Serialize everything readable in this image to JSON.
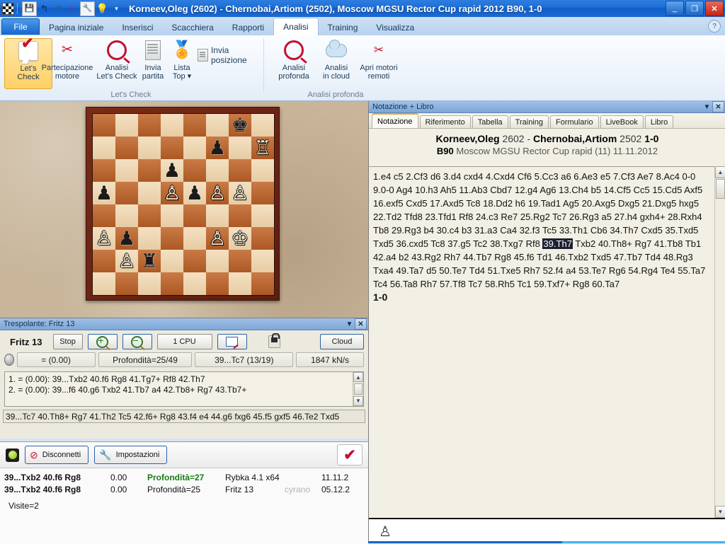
{
  "window": {
    "title": "Korneev,Oleg (2602) - Chernobai,Artiom (2502), Moscow MGSU Rector Cup rapid 2012  B90, 1-0",
    "quick_access": [
      "app-logo",
      "save-icon",
      "undo-icon",
      "redo-icon",
      "board-edit-icon",
      "wrench-icon",
      "lightbulb-icon",
      "chevron-down-icon"
    ],
    "controls": {
      "minimize": "_",
      "restore": "❐",
      "close": "✕"
    }
  },
  "ribbon": {
    "file_tab": "File",
    "tabs": [
      {
        "label": "Pagina iniziale",
        "active": false
      },
      {
        "label": "Inserisci",
        "active": false
      },
      {
        "label": "Scacchiera",
        "active": false
      },
      {
        "label": "Rapporti",
        "active": false
      },
      {
        "label": "Analisi",
        "active": true
      },
      {
        "label": "Training",
        "active": false
      },
      {
        "label": "Visualizza",
        "active": false
      }
    ],
    "help": "?",
    "groups": [
      {
        "name": "Let's Check",
        "buttons": [
          {
            "label": "Let's\nCheck",
            "icon": "lets-check-icon",
            "selected": true
          },
          {
            "label": "Partecipazione\nmotore",
            "icon": "engine-participation-icon",
            "selected": false
          },
          {
            "label": "Analisi\nLet's Check",
            "icon": "analysis-lets-check-icon",
            "selected": false
          },
          {
            "label": "Invia\npartita",
            "icon": "send-game-icon",
            "selected": false
          },
          {
            "label": "Lista\nTop ▾",
            "icon": "top-list-icon",
            "selected": false
          }
        ],
        "small_buttons": [
          {
            "label": "Invia posizione",
            "icon": "send-position-icon"
          }
        ]
      },
      {
        "name": "Analisi profonda",
        "buttons": [
          {
            "label": "Analisi\nprofonda",
            "icon": "deep-analysis-icon",
            "selected": false
          },
          {
            "label": "Analisi\nin cloud",
            "icon": "cloud-analysis-icon",
            "selected": false
          },
          {
            "label": "Apri motori\nremoti",
            "icon": "open-remote-engines-icon",
            "selected": false
          }
        ],
        "small_buttons": []
      }
    ]
  },
  "board": {
    "orientation": "white-bottom",
    "pieces": [
      {
        "square": "g8",
        "piece": "black-king",
        "glyph": "♚",
        "color": "b"
      },
      {
        "square": "f7",
        "piece": "black-pawn",
        "glyph": "♟",
        "color": "b"
      },
      {
        "square": "h7",
        "piece": "white-rook",
        "glyph": "♖",
        "color": "w"
      },
      {
        "square": "d6",
        "piece": "black-pawn",
        "glyph": "♟",
        "color": "b"
      },
      {
        "square": "a5",
        "piece": "black-pawn",
        "glyph": "♟",
        "color": "b"
      },
      {
        "square": "d5",
        "piece": "white-pawn",
        "glyph": "♙",
        "color": "w"
      },
      {
        "square": "e5",
        "piece": "black-pawn",
        "glyph": "♟",
        "color": "b"
      },
      {
        "square": "f5",
        "piece": "white-pawn",
        "glyph": "♙",
        "color": "w"
      },
      {
        "square": "g5",
        "piece": "white-pawn",
        "glyph": "♙",
        "color": "w"
      },
      {
        "square": "a3",
        "piece": "white-pawn",
        "glyph": "♙",
        "color": "w"
      },
      {
        "square": "b3",
        "piece": "black-pawn",
        "glyph": "♟",
        "color": "b"
      },
      {
        "square": "f3",
        "piece": "white-pawn",
        "glyph": "♙",
        "color": "w"
      },
      {
        "square": "g3",
        "piece": "white-king",
        "glyph": "♔",
        "color": "w"
      },
      {
        "square": "b2",
        "piece": "white-pawn",
        "glyph": "♙",
        "color": "w"
      },
      {
        "square": "c2",
        "piece": "black-rook",
        "glyph": "♜",
        "color": "b"
      }
    ]
  },
  "engine_panel": {
    "caption": "Trespolante: Fritz 13",
    "engine_name": "Fritz 13",
    "stop_label": "Stop",
    "zoom_in": "zoom-in",
    "zoom_out": "zoom-out",
    "cpu_label": "1 CPU",
    "edit_label": "edit",
    "lock_label": "lock",
    "cloud_label": "Cloud",
    "evaluation": "=  (0.00)",
    "depth": "Profondità=25/49",
    "current_move": "39...Tc7 (13/19)",
    "speed": "1847 kN/s",
    "variations": [
      "1. =  (0.00): 39...Txb2 40.f6 Rg8 41.Tg7+ Rf8 42.Th7",
      "2. =  (0.00): 39...f6 40.g6 Txb2 41.Tb7 a4 42.Tb8+ Rg7 43.Tb7+"
    ],
    "bottom_line": "39...Tc7 40.Th8+ Rg7 41.Th2 Tc5 42.f6+ Rg8 43.f4 e4 44.g6 fxg6 45.f5 gxf5 46.Te2 Txd5"
  },
  "lets_check_panel": {
    "status_led": "green",
    "disconnect_label": "Disconnetti",
    "settings_label": "Impostazioni",
    "flag_icon": "lets-check-flag-icon",
    "rows": [
      {
        "move": "39...Txb2 40.f6 Rg8",
        "eval": "0.00",
        "depth": "Profondità=27",
        "engine": "Rybka 4.1 x64",
        "user": "",
        "date": "11.11.2",
        "highlight": true
      },
      {
        "move": "39...Txb2 40.f6 Rg8",
        "eval": "0.00",
        "depth": "Profondità=25",
        "engine": "Fritz 13",
        "user": "cyrano",
        "date": "05.12.2",
        "highlight": false
      }
    ],
    "visits": "Visite=2"
  },
  "notation_panel": {
    "caption": "Notazione + Libro",
    "tabs": [
      {
        "label": "Notazione",
        "active": true
      },
      {
        "label": "Riferimento",
        "active": false
      },
      {
        "label": "Tabella",
        "active": false
      },
      {
        "label": "Training",
        "active": false
      },
      {
        "label": "Formulario",
        "active": false
      },
      {
        "label": "LiveBook",
        "active": false
      },
      {
        "label": "Libro",
        "active": false
      }
    ],
    "header": {
      "white": "Korneev,Oleg",
      "white_elo": "2602",
      "dash": "-",
      "black": "Chernobai,Artiom",
      "black_elo": "2502",
      "result": "1-0",
      "eco": "B90",
      "event": "Moscow MGSU Rector Cup rapid (11) 11.11.2012"
    },
    "moves_before": "1.e4 c5 2.Cf3 d6 3.d4 cxd4 4.Cxd4 Cf6 5.Cc3 a6 6.Ae3 e5 7.Cf3 Ae7 8.Ac4 0-0 9.0-0 Ag4 10.h3 Ah5 11.Ab3 Cbd7 12.g4 Ag6 13.Ch4 b5 14.Cf5 Cc5 15.Cd5 Axf5 16.exf5 Cxd5 17.Axd5 Tc8 18.Dd2 h6 19.Tad1 Ag5 20.Axg5 Dxg5 21.Dxg5 hxg5 22.Td2 Tfd8 23.Tfd1 Rf8 24.c3 Re7 25.Rg2 Tc7 26.Rg3 a5 27.h4 gxh4+ 28.Rxh4 Tb8 29.Rg3 b4 30.c4 b3 31.a3 Ca4 32.f3 Tc5 33.Th1 Cb6 34.Th7 Cxd5 35.Txd5 Txd5 36.cxd5 Tc8 37.g5 Tc2 38.Txg7 Rf8 ",
    "current_move": "39.Th7",
    "moves_after": " Txb2 40.Th8+ Rg7 41.Tb8 Tb1 42.a4 b2 43.Rg2 Rh7 44.Tb7 Rg8 45.f6 Td1 46.Txb2 Txd5 47.Tb7 Td4 48.Rg3 Txa4 49.Ta7 d5 50.Te7 Td4 51.Txe5 Rh7 52.f4 a4 53.Te7 Rg6 54.Rg4 Te4 55.Ta7 Tc4 56.Ta8 Rh7 57.Tf8 Tc7 58.Rh5 Tc1 59.Txf7+ Rg8 60.Ta7 ",
    "result_text": "1-0",
    "status_icon": "white-pawn-icon"
  }
}
